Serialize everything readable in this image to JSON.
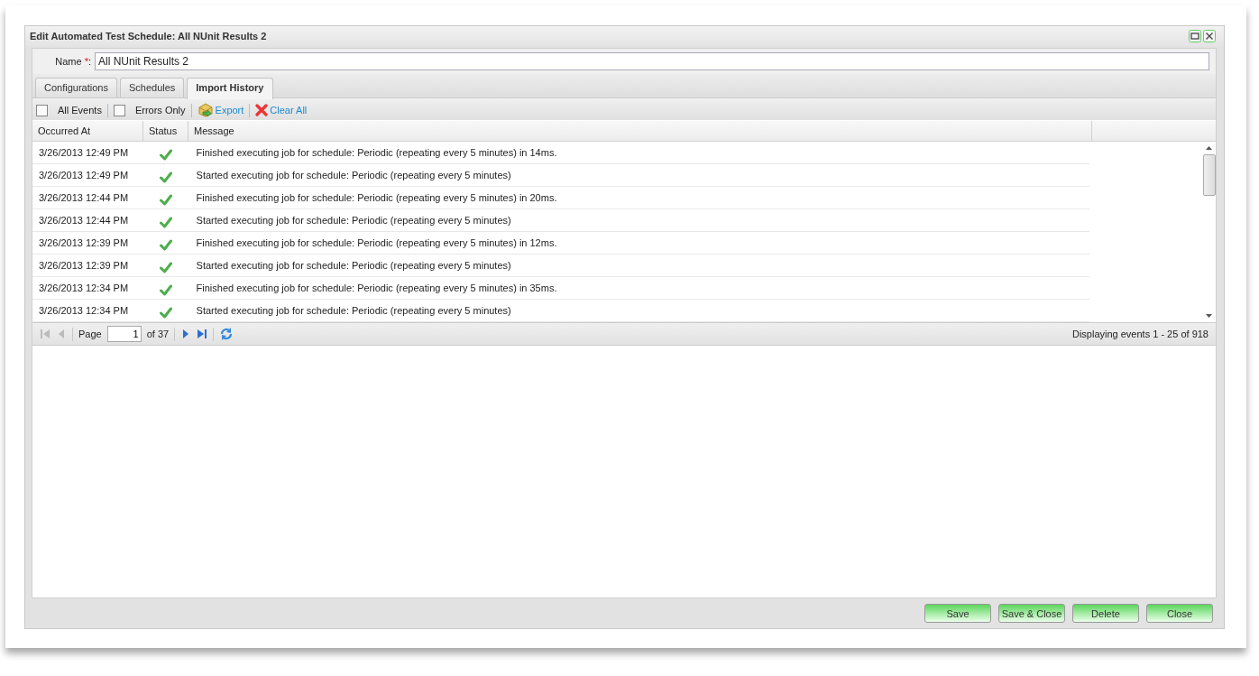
{
  "window": {
    "title": "Edit Automated Test Schedule: All NUnit Results 2"
  },
  "name_field": {
    "label": "Name",
    "required_mark": "*",
    "colon": ":",
    "value": "All NUnit Results 2"
  },
  "tabs": [
    {
      "label": "Configurations",
      "selected": false
    },
    {
      "label": "Schedules",
      "selected": false
    },
    {
      "label": "Import History",
      "selected": true
    }
  ],
  "toolbar": {
    "filters": [
      {
        "label": "All Events",
        "checked": false
      },
      {
        "label": "Errors Only",
        "checked": false
      }
    ],
    "export": "Export",
    "clear": "Clear All"
  },
  "table": {
    "columns": [
      "Occurred At",
      "Status",
      "Message"
    ],
    "rows": [
      {
        "occurred": "3/26/2013 12:49 PM",
        "succeeded": true,
        "message": "Finished executing job for schedule: Periodic (repeating every 5 minutes) in 14ms."
      },
      {
        "occurred": "3/26/2013 12:49 PM",
        "succeeded": true,
        "message": "Started executing job for schedule: Periodic (repeating every 5 minutes)"
      },
      {
        "occurred": "3/26/2013 12:44 PM",
        "succeeded": true,
        "message": "Finished executing job for schedule: Periodic (repeating every 5 minutes) in 20ms."
      },
      {
        "occurred": "3/26/2013 12:44 PM",
        "succeeded": true,
        "message": "Started executing job for schedule: Periodic (repeating every 5 minutes)"
      },
      {
        "occurred": "3/26/2013 12:39 PM",
        "succeeded": true,
        "message": "Finished executing job for schedule: Periodic (repeating every 5 minutes) in 12ms."
      },
      {
        "occurred": "3/26/2013 12:39 PM",
        "succeeded": true,
        "message": "Started executing job for schedule: Periodic (repeating every 5 minutes)"
      },
      {
        "occurred": "3/26/2013 12:34 PM",
        "succeeded": true,
        "message": "Finished executing job for schedule: Periodic (repeating every 5 minutes) in 35ms."
      },
      {
        "occurred": "3/26/2013 12:34 PM",
        "succeeded": true,
        "message": "Started executing job for schedule: Periodic (repeating every 5 minutes)"
      }
    ]
  },
  "pager": {
    "page_label": "Page",
    "page": "1",
    "of": "of 37",
    "summary": "Displaying events 1 - 25 of 918"
  },
  "buttons": [
    "Save",
    "Save & Close",
    "Delete",
    "Close"
  ]
}
